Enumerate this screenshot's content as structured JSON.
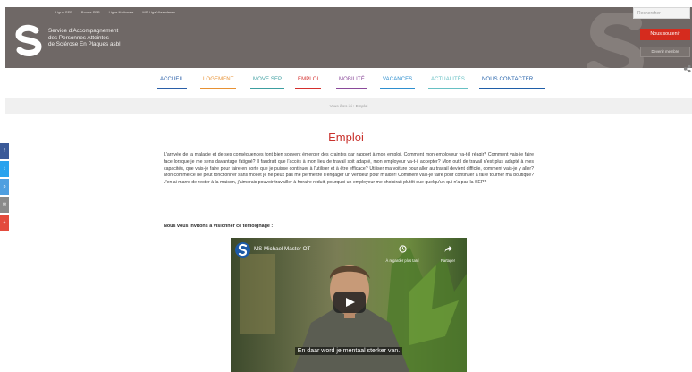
{
  "header": {
    "top_links": [
      "Ligue SEP",
      "Bouee SEP",
      "Ligue Nationale",
      "MS-Liga Vlaanderen"
    ],
    "org_name_lines": [
      "Service d'Accompagnement",
      "des Personnes Atteintes",
      "de Sclérose En Plaques asbl"
    ],
    "search_placeholder": "Rechercher",
    "donate_label": "Nous soutenir",
    "member_label": "Devenir membre",
    "brand_color": "#6f6866",
    "accent_color": "#d52b1e"
  },
  "nav": {
    "items": [
      {
        "label": "ACCUEIL",
        "color": "#2a5fa8"
      },
      {
        "label": "LOGEMENT",
        "color": "#e79133"
      },
      {
        "label": "MOVE SEP",
        "color": "#3c9ea0"
      },
      {
        "label": "EMPLOI",
        "color": "#d42f2d"
      },
      {
        "label": "MOBILITÉ",
        "color": "#8a4a9a"
      },
      {
        "label": "VACANCES",
        "color": "#2e8fcf"
      },
      {
        "label": "ACTUALITÉS",
        "color": "#67c0c4"
      },
      {
        "label": "NOUS CONTACTER",
        "color": "#1f5ea8"
      }
    ]
  },
  "breadcrumb": {
    "text": "Vous êtes ici : Emploi"
  },
  "social": [
    {
      "icon": "facebook-icon",
      "color": "#3b5a98",
      "glyph": "f"
    },
    {
      "icon": "twitter-icon",
      "color": "#2aa3ee",
      "glyph": "t"
    },
    {
      "icon": "pinterest-icon",
      "color": "#4f9fe0",
      "glyph": "p"
    },
    {
      "icon": "email-icon",
      "color": "#8a8a8a",
      "glyph": "✉"
    },
    {
      "icon": "plus-icon",
      "color": "#e34b3d",
      "glyph": "+"
    }
  ],
  "content": {
    "title": "Emploi",
    "paragraph": "L'arrivée de la maladie et de ses conséquences font bien souvent émerger des craintes par rapport à mon emploi. Comment mon employeur va-t-il réagir? Comment vais-je faire face lorsque je me sens davantage fatigué? Il faudrait que l'accès à mon lieu de travail soit adapté, mon employeur va-t-il accepter? Mon outil de travail n'est plus adapté à mes capacités, que vais-je faire pour faire en sorte que je puisse continuer à l'utiliser et à être efficace? Utiliser ma voiture pour aller au travail devient difficile, comment vais-je y aller? Mon commerce ne peut fonctionner sans moi et je ne peux pas me permettre d'engager un vendeur pour m'aider! Comment vais-je faire pour continuer à faire tourner ma boutique? J'en ai marre de rester à la maison, j'aimerais pouvoir travailler à horaire réduit, pourquoi un employeur me choisirait plutôt que quelqu'un qui n'a pas la SEP?",
    "subhead": "Nous vous invitons à visionner ce témoignage :"
  },
  "video": {
    "title": "MS Michael Master OT",
    "watch_later_label": "À regarder plus tard",
    "share_label": "Partager",
    "subtitle": "En daar word je mentaal sterker van."
  }
}
